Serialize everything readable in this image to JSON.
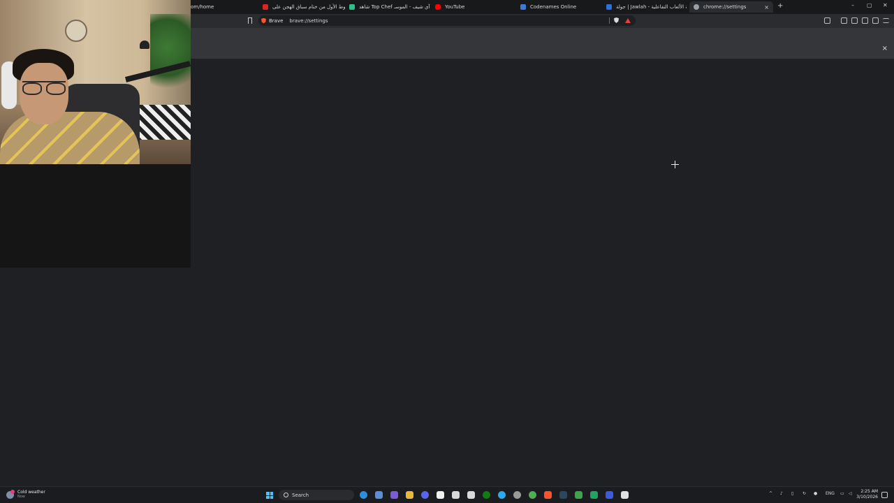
{
  "browser": {
    "tabs": [
      {
        "title": "om/home",
        "active": false
      },
      {
        "title": "الشوط الأول من ختام سباق الهجن على...",
        "active": false,
        "favicon_color": "#e02424"
      },
      {
        "title": "شاهد Top Chef سش آي شيف - الموسـ...",
        "active": false,
        "favicon_color": "#2fbf8a"
      },
      {
        "title": "YouTube",
        "active": false,
        "favicon_color": "#ff0000"
      },
      {
        "title": "Codenames Online",
        "active": false,
        "favicon_color": "#3a7bd5"
      },
      {
        "title": "جولة | Jawlah - منصة الألعاب التفاعلية",
        "active": false,
        "favicon_color": "#2f6fd6"
      },
      {
        "title": "chrome://settings",
        "active": true,
        "favicon_color": "#9aa0a6"
      }
    ],
    "new_tab_symbol": "+",
    "tab_close_symbol": "×",
    "window_controls": {
      "minimize": "–",
      "maximize": "▢",
      "close": "✕"
    },
    "omnibox": {
      "chip_label": "Brave",
      "url": "brave://settings"
    },
    "settings_band_close": "×"
  },
  "taskbar": {
    "weather": {
      "title": "Cold weather",
      "subtitle": "Now"
    },
    "search_placeholder": "Search",
    "tray": {
      "language": "ENG",
      "chevron": "^"
    },
    "clock": {
      "time": "2:25 AM",
      "date": "3/10/2026"
    }
  },
  "colors": {
    "accent_brave": "#fb542b",
    "page_bg": "#1f2023",
    "settings_band": "#35363a",
    "start_blue": "#4cc2ff"
  }
}
